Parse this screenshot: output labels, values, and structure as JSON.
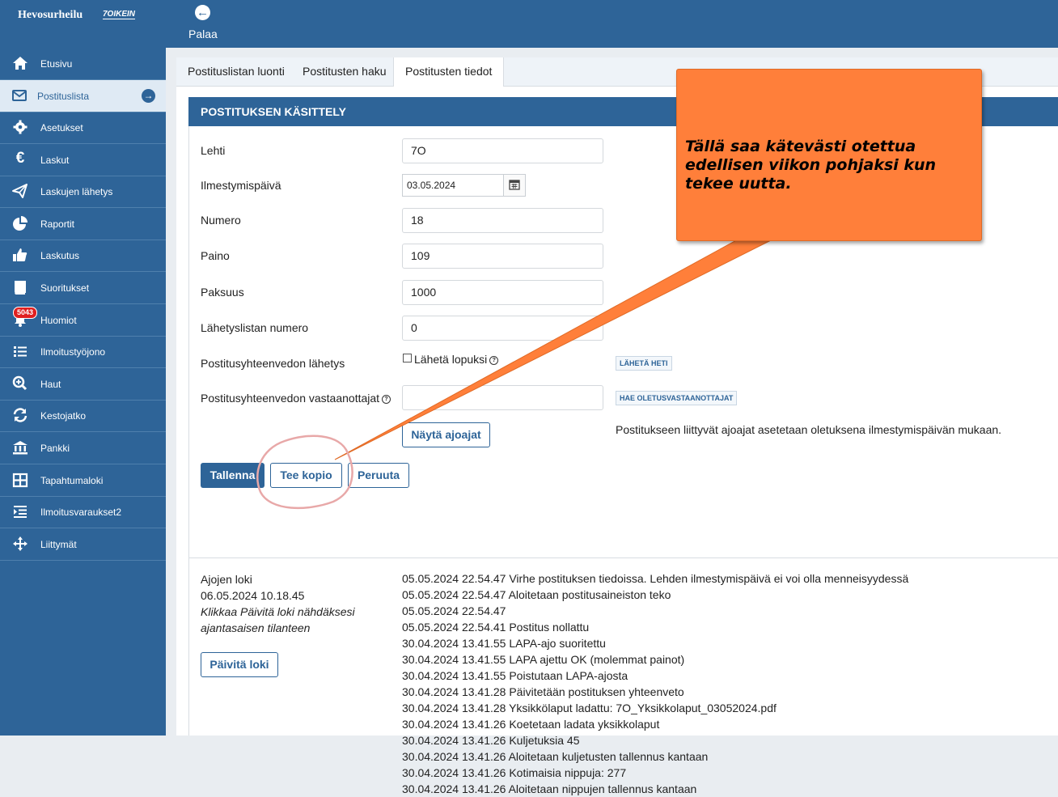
{
  "topbar": {
    "logo": "Hevosurheilu",
    "logo2": "7OIKEIN",
    "back_label": "Palaa"
  },
  "sidebar": {
    "items": [
      {
        "label": "Etusivu",
        "icon": "home-icon"
      },
      {
        "label": "Postituslista",
        "icon": "envelope-icon"
      },
      {
        "label": "Asetukset",
        "icon": "gear-icon"
      },
      {
        "label": "Laskut",
        "icon": "euro-icon"
      },
      {
        "label": "Laskujen lähetys",
        "icon": "send-icon"
      },
      {
        "label": "Raportit",
        "icon": "pie-chart-icon"
      },
      {
        "label": "Laskutus",
        "icon": "thumbs-up-icon"
      },
      {
        "label": "Suoritukset",
        "icon": "book-icon"
      },
      {
        "label": "Huomiot",
        "icon": "bell-icon",
        "badge": "5043"
      },
      {
        "label": "Ilmoitustyöjono",
        "icon": "list-icon"
      },
      {
        "label": "Haut",
        "icon": "search-plus-icon"
      },
      {
        "label": "Kestojatko",
        "icon": "sync-icon"
      },
      {
        "label": "Pankki",
        "icon": "bank-icon"
      },
      {
        "label": "Tapahtumaloki",
        "icon": "grid-icon"
      },
      {
        "label": "Ilmoitusvaraukset2",
        "icon": "indent-icon"
      },
      {
        "label": "Liittymät",
        "icon": "move-icon"
      }
    ]
  },
  "tabs": [
    "Postituslistan luonti",
    "Postitusten haku",
    "Postitusten tiedot"
  ],
  "panel": {
    "title": "POSTITUKSEN KÄSITTELY",
    "fields": {
      "lehti_label": "Lehti",
      "lehti_value": "7O",
      "ilmestymispaiva_label": "Ilmestymispäivä",
      "ilmestymispaiva_value": "03.05.2024",
      "numero_label": "Numero",
      "numero_value": "18",
      "paino_label": "Paino",
      "paino_value": "109",
      "paksuus_label": "Paksuus",
      "paksuus_value": "1000",
      "lahetyslista_label": "Lähetyslistan numero",
      "lahetyslista_value": "0",
      "yhteenveto_lahetys_label": "Postitusyhteenvedon lähetys",
      "laheta_lopuksi_label": "Lähetä lopuksi",
      "laheta_lopuksi_checked": false,
      "laheta_heti_button": "LÄHETÄ HETI",
      "vastaanottajat_label": "Postitusyhteenvedon vastaanottajat",
      "vastaanottajat_value": "",
      "hae_oletus_button": "HAE OLETUSVASTAANOTTAJAT",
      "nayta_ajoajat_button": "Näytä ajoajat",
      "ajoajat_note": "Postitukseen liittyvät ajoajat asetetaan oletuksena ilmestymispäivän mukaan."
    },
    "actions": {
      "save": "Tallenna",
      "copy": "Tee kopio",
      "cancel": "Peruuta"
    },
    "log": {
      "title": "Ajojen loki",
      "timestamp": "06.05.2024 10.18.45",
      "hint_line1": "Klikkaa Päivitä loki nähdäksesi",
      "hint_line2": "ajantasaisen tilanteen",
      "refresh_button": "Päivitä loki",
      "entries": [
        "05.05.2024 22.54.47 Virhe postituksen tiedoissa. Lehden ilmestymispäivä ei voi olla menneisyydessä",
        "05.05.2024 22.54.47 Aloitetaan postitusaineiston teko",
        "05.05.2024 22.54.47",
        "05.05.2024 22.54.41 Postitus nollattu",
        "30.04.2024 13.41.55 LAPA-ajo suoritettu",
        "30.04.2024 13.41.55 LAPA ajettu OK (molemmat painot)",
        "30.04.2024 13.41.55 Poistutaan LAPA-ajosta",
        "30.04.2024 13.41.28 Päivitetään postituksen yhteenveto",
        "30.04.2024 13.41.28 Yksikkölaput ladattu: 7O_Yksikkolaput_03052024.pdf",
        "30.04.2024 13.41.26 Koetetaan ladata yksikkolaput",
        "30.04.2024 13.41.26 Kuljetuksia 45",
        "30.04.2024 13.41.26 Aloitetaan kuljetusten tallennus kantaan",
        "30.04.2024 13.41.26 Kotimaisia nippuja: 277",
        "30.04.2024 13.41.26 Aloitetaan nippujen tallennus kantaan"
      ]
    }
  },
  "callout": {
    "text": "Tällä saa kätevästi otettua edellisen viikon pohjaksi kun tekee uutta."
  },
  "colors": {
    "brand": "#2e6498",
    "callout": "#ff7f3a",
    "highlight_circle": "#e8a8a8"
  }
}
